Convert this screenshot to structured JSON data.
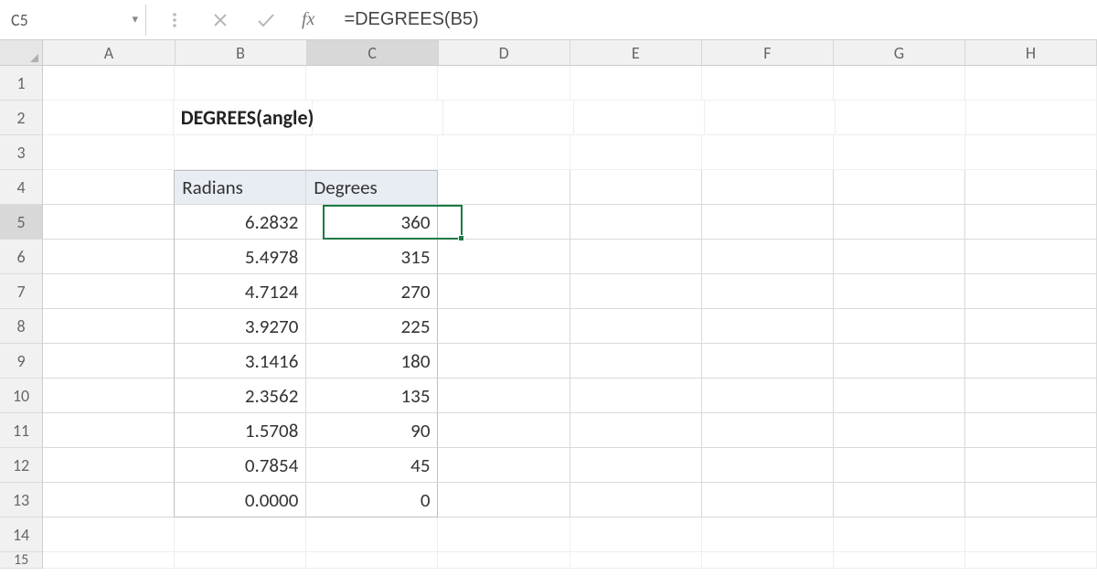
{
  "formula_bar": {
    "cell_ref": "C5",
    "formula": "=DEGREES(B5)",
    "fx_label": "fx"
  },
  "columns": [
    "A",
    "B",
    "C",
    "D",
    "E",
    "F",
    "G",
    "H"
  ],
  "rows": [
    "1",
    "2",
    "3",
    "4",
    "5",
    "6",
    "7",
    "8",
    "9",
    "10",
    "11",
    "12",
    "13",
    "14",
    "15"
  ],
  "active_column": "C",
  "active_row": "5",
  "title": "DEGREES(angle)",
  "table": {
    "headers": {
      "radians": "Radians",
      "degrees": "Degrees"
    },
    "rows": [
      {
        "radians": "6.2832",
        "degrees": "360"
      },
      {
        "radians": "5.4978",
        "degrees": "315"
      },
      {
        "radians": "4.7124",
        "degrees": "270"
      },
      {
        "radians": "3.9270",
        "degrees": "225"
      },
      {
        "radians": "3.1416",
        "degrees": "180"
      },
      {
        "radians": "2.3562",
        "degrees": "135"
      },
      {
        "radians": "1.5708",
        "degrees": "90"
      },
      {
        "radians": "0.7854",
        "degrees": "45"
      },
      {
        "radians": "0.0000",
        "degrees": "0"
      }
    ]
  }
}
